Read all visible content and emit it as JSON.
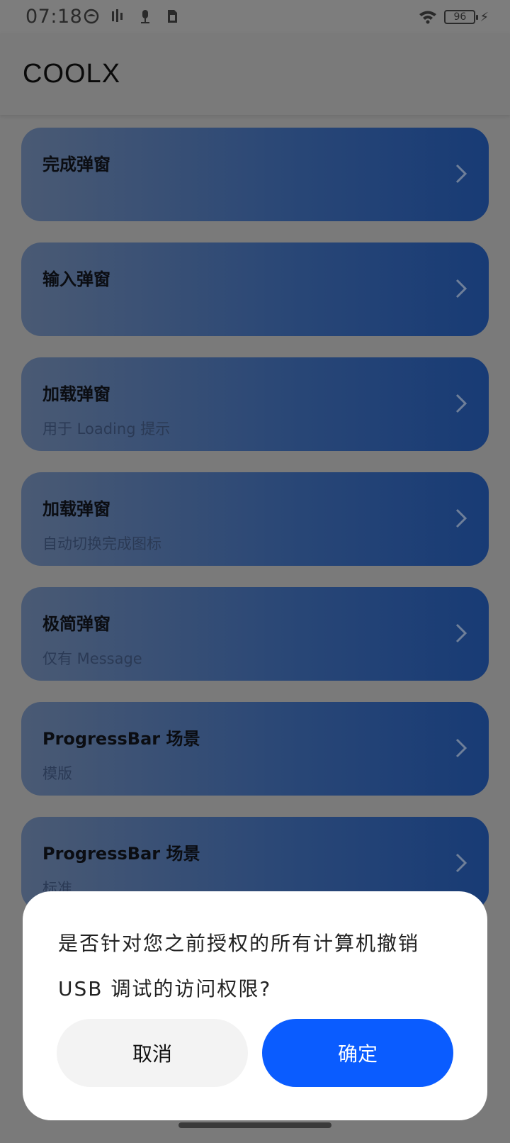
{
  "status_bar": {
    "time": "07:18",
    "battery": "96",
    "icons": [
      "app-circle-icon",
      "signal-bars-icon",
      "mic-icon",
      "sim-card-icon",
      "wifi-icon",
      "battery-icon",
      "charging-bolt-icon"
    ]
  },
  "app": {
    "title": "COOLX"
  },
  "cards": [
    {
      "title": "完成弹窗",
      "subtitle": ""
    },
    {
      "title": "输入弹窗",
      "subtitle": ""
    },
    {
      "title": "加载弹窗",
      "subtitle": "用于 Loading 提示"
    },
    {
      "title": "加载弹窗",
      "subtitle": "自动切换完成图标"
    },
    {
      "title": "极简弹窗",
      "subtitle": "仅有 Message"
    },
    {
      "title": "ProgressBar 场景",
      "subtitle": "模版"
    },
    {
      "title": "ProgressBar 场景",
      "subtitle": "标准"
    }
  ],
  "dialog": {
    "message": "是否针对您之前授权的所有计算机撤销USB 调试的访问权限?",
    "cancel": "取消",
    "confirm": "确定"
  },
  "colors": {
    "accent": "#0a5cff",
    "scrim": "#7a7a7a",
    "card_gradient_start": "#4a5a74",
    "card_gradient_end": "#183b75"
  }
}
